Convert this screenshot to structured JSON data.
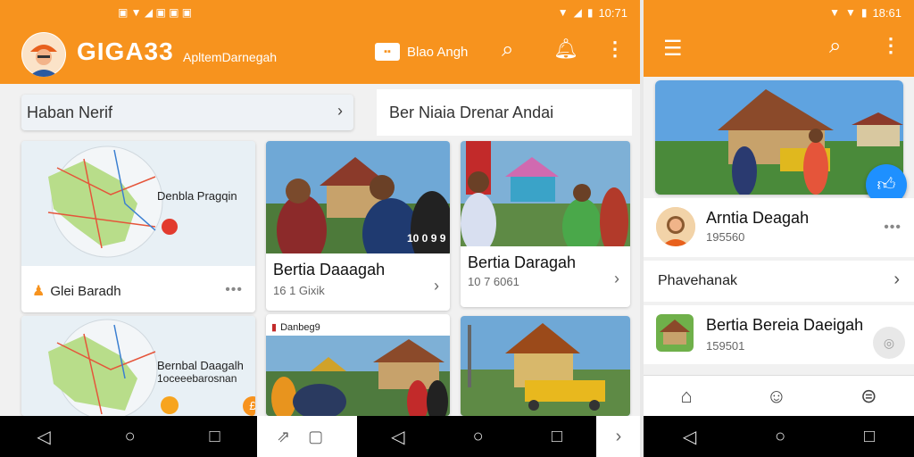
{
  "left_status": {
    "time": "10:71"
  },
  "right_status": {
    "time": "18:61"
  },
  "app": {
    "name": "GIGA33",
    "tagline": "ApltemDarnegah",
    "action_label": "Blao Angh"
  },
  "search_bar": {
    "label": "Haban Nerif"
  },
  "section_header": {
    "label": "Ber Niaia Drenar Andai"
  },
  "map_cards": [
    {
      "map_label": "Denbla Pragqin",
      "title": "Glei Baradh"
    },
    {
      "map_label": "Bernbal Daagalh",
      "sub_label": "1oceeebarosnan"
    }
  ],
  "posts": [
    {
      "title": "Bertia Daaagah",
      "meta": "16 1 Gixik",
      "overlay": "10 0 9 9"
    },
    {
      "title": "Bertia Daragah",
      "meta": "10 7 6061"
    },
    {
      "label": "Danbeg9"
    }
  ],
  "right_panel": {
    "profile": {
      "name": "Arntia Deagah",
      "meta": "195560"
    },
    "row_label": "Phavehanak",
    "item": {
      "title": "Bertia Bereia Daeigah",
      "meta": "159501"
    }
  },
  "colors": {
    "accent": "#f7931e",
    "fab": "#1e90ff"
  }
}
